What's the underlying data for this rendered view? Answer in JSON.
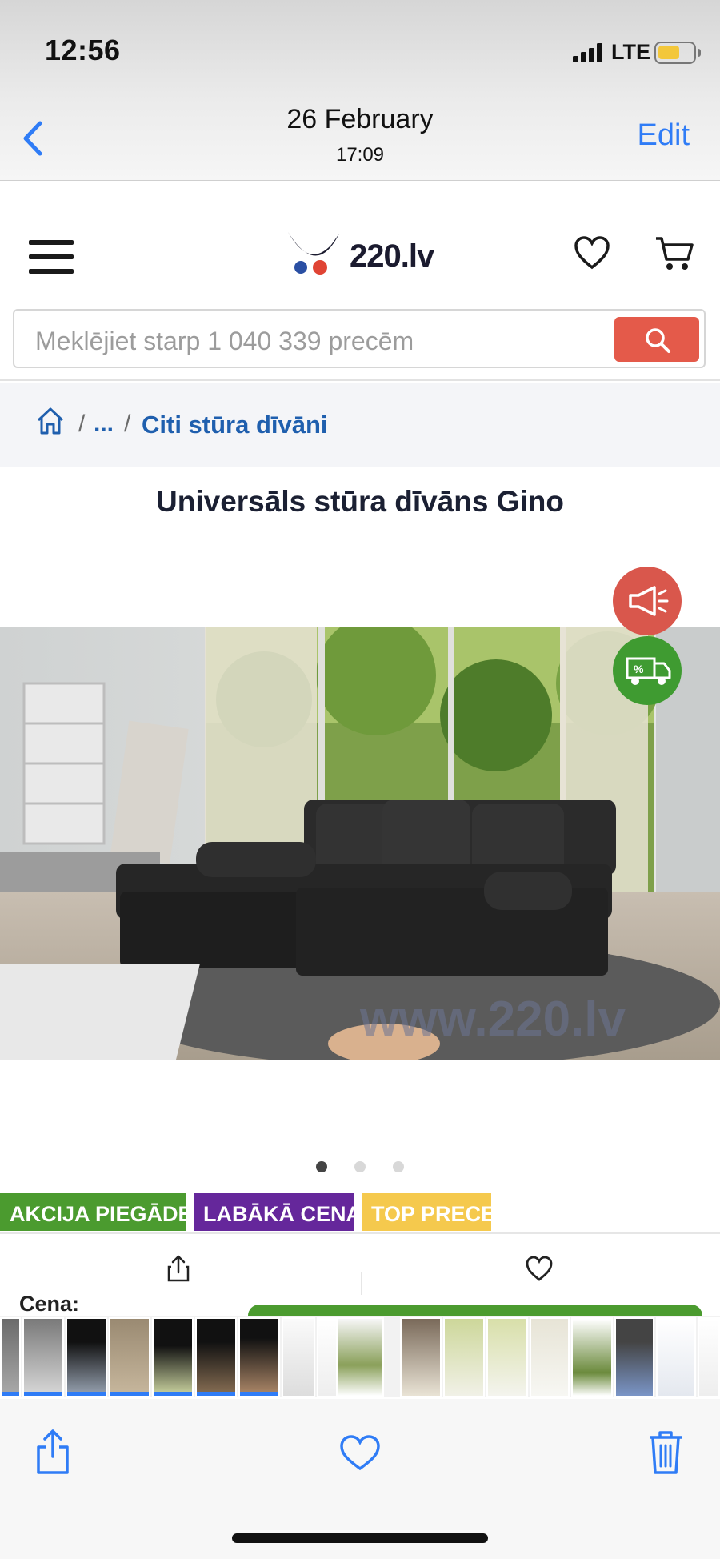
{
  "status_bar": {
    "time": "12:56",
    "network": "LTE"
  },
  "photos_nav": {
    "date": "26 February",
    "time": "17:09",
    "edit_label": "Edit"
  },
  "site": {
    "logo_text": "220.lv",
    "search_placeholder": "Meklējiet starp 1 040 339 precēm"
  },
  "breadcrumb": {
    "sep": "/",
    "ellipsis": "...",
    "current": "Citi stūra dīvāni"
  },
  "product": {
    "title": "Universāls stūra dīvāns Gino",
    "image_count": 3,
    "active_image": 1,
    "tags": [
      "AKCIJA PIEGĀDEI",
      "LABĀKĀ CENA",
      "TOP PRECE"
    ],
    "price_label": "Cena:",
    "watermark": "www.220.lv"
  },
  "colors": {
    "ios_blue": "#2f7cf6",
    "search_red": "#e45a4a",
    "link_blue": "#1f5fae",
    "tag_green": "#4b9b2f",
    "tag_purple": "#65279b",
    "tag_yellow": "#f5c94d"
  },
  "icons": {
    "back": "chevron-left-icon",
    "menu": "hamburger-menu-icon",
    "wishlist": "heart-icon",
    "cart": "cart-icon",
    "search": "search-icon",
    "home": "home-icon",
    "promo": "megaphone-icon",
    "delivery": "truck-discount-icon",
    "share": "share-icon",
    "favorite": "heart-icon",
    "delete": "trash-icon"
  }
}
